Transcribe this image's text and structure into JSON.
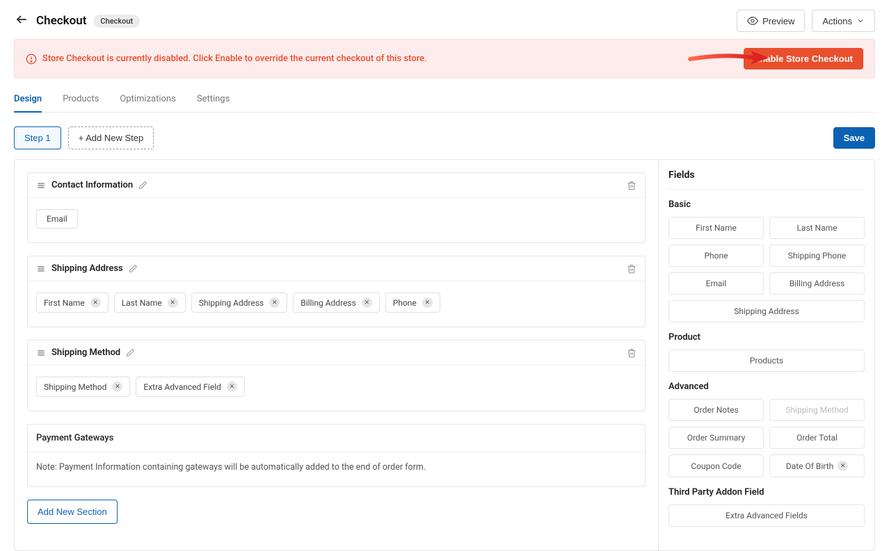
{
  "header": {
    "title": "Checkout",
    "badge": "Checkout",
    "preview_label": "Preview",
    "actions_label": "Actions"
  },
  "alert": {
    "message": "Store Checkout is currently disabled. Click Enable to override the current checkout of this store.",
    "button_label": "Enable Store Checkout"
  },
  "tabs": [
    {
      "label": "Design",
      "active": true
    },
    {
      "label": "Products",
      "active": false
    },
    {
      "label": "Optimizations",
      "active": false
    },
    {
      "label": "Settings",
      "active": false
    }
  ],
  "steps": {
    "step1_label": "Step 1",
    "add_step_label": "+ Add New Step",
    "save_label": "Save"
  },
  "sections": [
    {
      "title": "Contact Information",
      "editable": true,
      "deletable": true,
      "chips": [
        {
          "label": "Email",
          "removable": false
        }
      ]
    },
    {
      "title": "Shipping Address",
      "editable": true,
      "deletable": true,
      "chips": [
        {
          "label": "First Name",
          "removable": true
        },
        {
          "label": "Last Name",
          "removable": true
        },
        {
          "label": "Shipping Address",
          "removable": true
        },
        {
          "label": "Billing Address",
          "removable": true
        },
        {
          "label": "Phone",
          "removable": true
        }
      ]
    },
    {
      "title": "Shipping Method",
      "editable": true,
      "deletable": true,
      "chips": [
        {
          "label": "Shipping Method",
          "removable": true
        },
        {
          "label": "Extra Advanced Field",
          "removable": true
        }
      ]
    }
  ],
  "payment": {
    "title": "Payment Gateways",
    "note": "Note: Payment Information containing gateways will be automatically added to the end of order form."
  },
  "add_section_label": "Add New Section",
  "fields_panel": {
    "title": "Fields",
    "groups": [
      {
        "title": "Basic",
        "items": [
          {
            "label": "First Name"
          },
          {
            "label": "Last Name"
          },
          {
            "label": "Phone"
          },
          {
            "label": "Shipping Phone"
          },
          {
            "label": "Email"
          },
          {
            "label": "Billing Address"
          },
          {
            "label": "Shipping Address",
            "full": true
          }
        ]
      },
      {
        "title": "Product",
        "items": [
          {
            "label": "Products",
            "full": true
          }
        ]
      },
      {
        "title": "Advanced",
        "items": [
          {
            "label": "Order Notes"
          },
          {
            "label": "Shipping Method",
            "disabled": true
          },
          {
            "label": "Order Summary"
          },
          {
            "label": "Order Total"
          },
          {
            "label": "Coupon Code"
          },
          {
            "label": "Date Of Birth",
            "removable": true
          }
        ]
      },
      {
        "title": "Third Party Addon Field",
        "items": [
          {
            "label": "Extra Advanced Fields",
            "full": true
          }
        ]
      }
    ]
  }
}
